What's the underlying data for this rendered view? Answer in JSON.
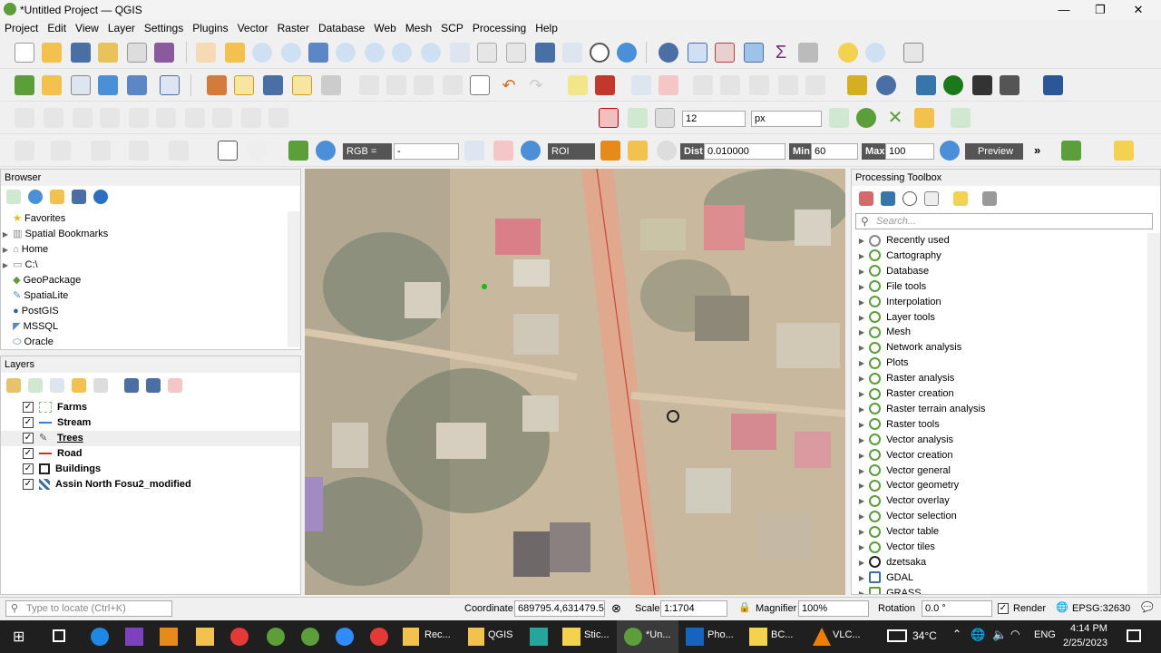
{
  "window": {
    "title": "*Untitled Project — QGIS",
    "min": "—",
    "max": "❐",
    "close": "✕"
  },
  "menu": [
    "Project",
    "Edit",
    "View",
    "Layer",
    "Settings",
    "Plugins",
    "Vector",
    "Raster",
    "Database",
    "Web",
    "Mesh",
    "SCP",
    "Processing",
    "Help"
  ],
  "digitize": {
    "snap_value": "12",
    "snap_unit": "px"
  },
  "scp": {
    "rgb": "RGB =",
    "rgb_value": "-",
    "roi": "ROI",
    "dist_label": "Dist",
    "dist_value": "0.010000",
    "min_label": "Min",
    "min_value": "60",
    "max_label": "Max",
    "max_value": "100",
    "preview": "Preview",
    "more": "»"
  },
  "browser": {
    "title": "Browser",
    "items": [
      {
        "label": "Favorites",
        "arrow": ""
      },
      {
        "label": "Spatial Bookmarks",
        "arrow": "▶"
      },
      {
        "label": "Home",
        "arrow": "▶"
      },
      {
        "label": "C:\\",
        "arrow": "▶"
      },
      {
        "label": "GeoPackage",
        "arrow": ""
      },
      {
        "label": "SpatiaLite",
        "arrow": ""
      },
      {
        "label": "PostGIS",
        "arrow": ""
      },
      {
        "label": "MSSQL",
        "arrow": ""
      },
      {
        "label": "Oracle",
        "arrow": ""
      }
    ]
  },
  "layers": {
    "title": "Layers",
    "items": [
      {
        "label": "Farms",
        "checked": "✓",
        "color": "#7cc67c"
      },
      {
        "label": "Stream",
        "checked": "✓",
        "color": "#3a7fd5"
      },
      {
        "label": "Trees",
        "checked": "✓",
        "color": "#555"
      },
      {
        "label": "Road",
        "checked": "✓",
        "color": "#c0392b"
      },
      {
        "label": "Buildings",
        "checked": "✓",
        "color": "#222"
      },
      {
        "label": "Assin North Fosu2_modified",
        "checked": "✓",
        "color": "#3c6ea8"
      }
    ]
  },
  "toolbox": {
    "title": "Processing Toolbox",
    "search_placeholder": "Search...",
    "items": [
      "Recently used",
      "Cartography",
      "Database",
      "File tools",
      "Interpolation",
      "Layer tools",
      "Mesh",
      "Network analysis",
      "Plots",
      "Raster analysis",
      "Raster creation",
      "Raster terrain analysis",
      "Raster tools",
      "Vector analysis",
      "Vector creation",
      "Vector general",
      "Vector geometry",
      "Vector overlay",
      "Vector selection",
      "Vector table",
      "Vector tiles",
      "dzetsaka",
      "GDAL",
      "GRASS"
    ]
  },
  "status": {
    "locate_placeholder": "Type to locate (Ctrl+K)",
    "coord_label": "Coordinate",
    "coord_value": "689795.4,631479.5",
    "scale_label": "Scale",
    "scale_value": "1:1704",
    "magnifier_label": "Magnifier",
    "magnifier_value": "100%",
    "rotation_label": "Rotation",
    "rotation_value": "0.0 °",
    "render_label": "Render",
    "render_checked": "✓",
    "epsg": "EPSG:32630"
  },
  "taskbar": {
    "apps": [
      "Rec...",
      "QGIS",
      "Stic...",
      "*Un...",
      "Pho...",
      "BC...",
      "VLC..."
    ],
    "temp": "34°C",
    "lang": "ENG",
    "time": "4:14 PM",
    "date": "2/25/2023"
  }
}
